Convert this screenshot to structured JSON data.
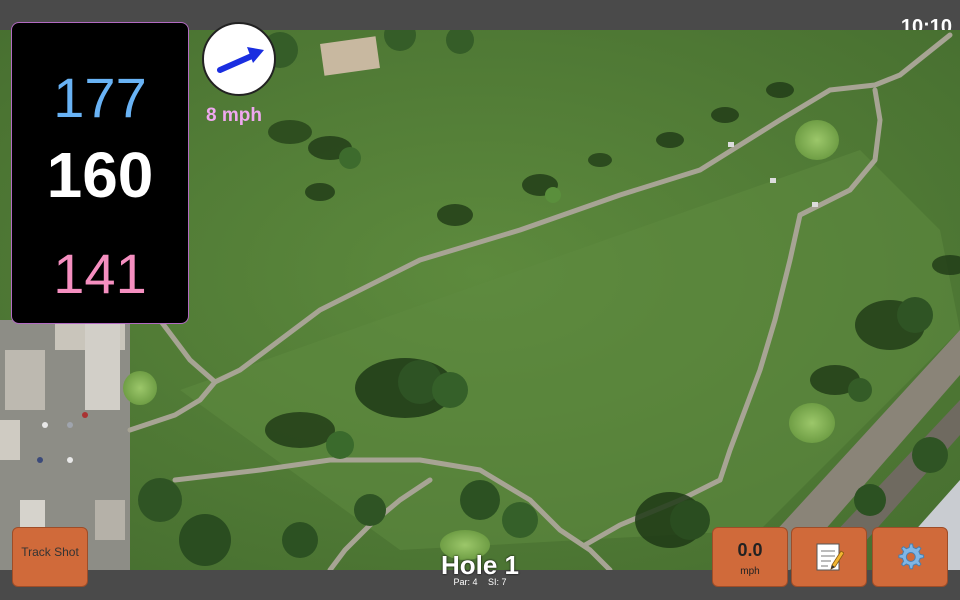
{
  "status": {
    "time": "10:10"
  },
  "distances": {
    "back": "177",
    "center": "160",
    "front": "141"
  },
  "wind": {
    "speed_label": "8 mph",
    "direction_icon": "arrow-up-right-icon",
    "arrow_color": "#1a2ee0"
  },
  "hole": {
    "title": "Hole 1",
    "par_label": "Par: 4",
    "si_label": "SI: 7"
  },
  "buttons": {
    "track_shot": "Track Shot",
    "wind_value": "0.0",
    "wind_unit": "mph",
    "notes_icon": "notepad-icon",
    "settings_icon": "gear-icon"
  },
  "colors": {
    "back": "#69b3f5",
    "center": "#ffffff",
    "front": "#f58fc0",
    "button": "#d06a3a",
    "panel_border": "#b26ac2"
  }
}
